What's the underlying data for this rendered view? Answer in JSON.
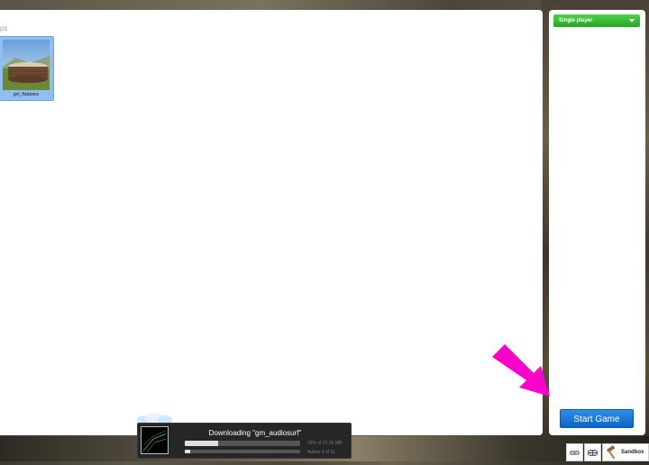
{
  "maps": {
    "section_title": "ps",
    "items": [
      {
        "name": "gm_flatgrass",
        "selected": true
      }
    ]
  },
  "side": {
    "mode_selected": "Single player",
    "start_label": "Start Game"
  },
  "download": {
    "title": "Downloading \"gm_audiosurf\"",
    "progress_pct": 29,
    "progress_text": "29% of 27.36 MB",
    "addon_progress": 0.044,
    "addon_text": "Addon 4 of 91"
  },
  "corner": {
    "sandbox_label": "Sandbox",
    "icons": [
      "gamepad-icon",
      "uk-flag-icon",
      "hammer-icon"
    ]
  },
  "colors": {
    "start_blue": "#1a78dc",
    "mode_green": "#2cb52a",
    "arrow_magenta": "#ff00cc",
    "selected_tile": "#8fbef0"
  }
}
